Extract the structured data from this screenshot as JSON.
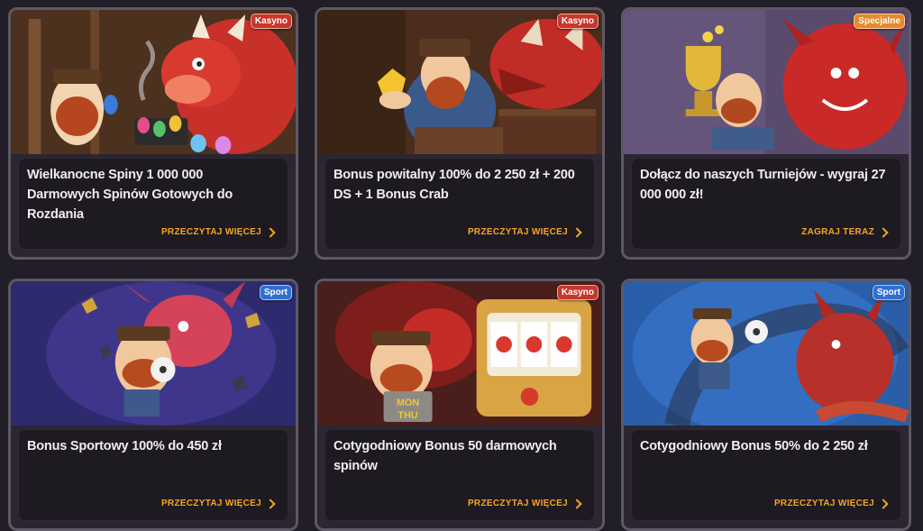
{
  "colors": {
    "accent": "#f5a623",
    "badge_casino": "#c9362a",
    "badge_special": "#e8892a",
    "badge_sport": "#2f6fd4"
  },
  "promotions": [
    {
      "badge": "Kasyno",
      "title": "Wielkanocne Spiny 1 000 000 Darmowych Spinów Gotowych do Rozdania",
      "cta": "PRZECZYTAJ WIĘCEJ"
    },
    {
      "badge": "Kasyno",
      "title": "Bonus powitalny 100% do 2 250 zł + 200 DS + 1 Bonus Crab",
      "cta": "PRZECZYTAJ WIĘCEJ"
    },
    {
      "badge": "Specjalne",
      "title": "Dołącz do naszych Turniejów - wygraj 27 000 000 zł!",
      "cta": "ZAGRAJ TERAZ"
    },
    {
      "badge": "Sport",
      "title": "Bonus Sportowy 100% do 450 zł",
      "cta": "PRZECZYTAJ WIĘCEJ"
    },
    {
      "badge": "Kasyno",
      "title": "Cotygodniowy Bonus 50 darmowych spinów",
      "cta": "PRZECZYTAJ WIĘCEJ"
    },
    {
      "badge": "Sport",
      "title": "Cotygodniowy Bonus 50% do 2 250 zł",
      "cta": "PRZECZYTAJ WIĘCEJ"
    }
  ],
  "slot_sign": {
    "line1": "MON",
    "line2": "THU"
  }
}
